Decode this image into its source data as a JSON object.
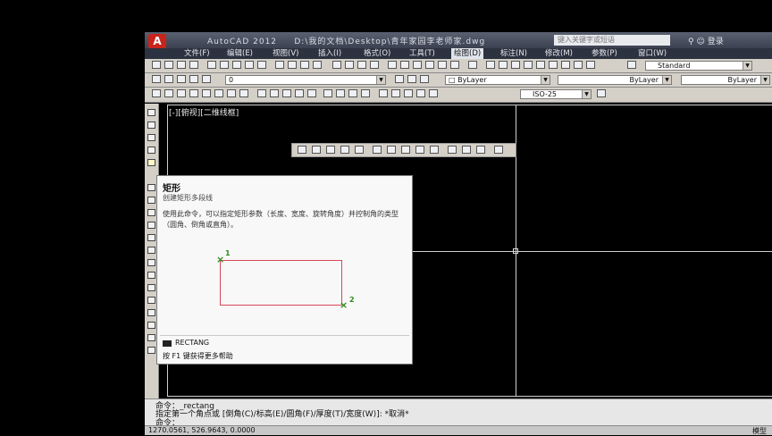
{
  "titlebar": {
    "app_name": "AutoCAD 2012",
    "file_path": "D:\\我的文档\\Desktop\\青年家园李老师家.dwg",
    "search_placeholder": "键入关键字或短语",
    "login": "登录"
  },
  "menu": {
    "items": [
      {
        "label": "文件(F)"
      },
      {
        "label": "编辑(E)"
      },
      {
        "label": "视图(V)"
      },
      {
        "label": "插入(I)"
      },
      {
        "label": "格式(O)"
      },
      {
        "label": "工具(T)"
      },
      {
        "label": "绘图(D)"
      },
      {
        "label": "标注(N)"
      },
      {
        "label": "修改(M)"
      },
      {
        "label": "参数(P)"
      },
      {
        "label": "窗口(W)"
      }
    ],
    "active_index": 6
  },
  "toolbar": {
    "text_style": "Standard",
    "layer": "0",
    "color": "ByLayer",
    "linetype": "ByLayer",
    "lineweight": "ByLayer",
    "dim_style": "ISO-25"
  },
  "canvas": {
    "viewport_label": "[-][俯视][二维线框]"
  },
  "tooltip": {
    "title": "矩形",
    "subtitle": "创建矩形多段线",
    "description": "使用此命令，可以指定矩形参数（长度、宽度、旋转角度）并控制角的类型（圆角、倒角或直角）。",
    "point1": "1",
    "point2": "2",
    "command": "RECTANG",
    "help": "按 F1 键获得更多帮助"
  },
  "command": {
    "line1": "命令：_rectang",
    "line2": "指定第一个角点或 [倒角(C)/标高(E)/圆角(F)/厚度(T)/宽度(W)]: *取消*",
    "line3": "命令："
  },
  "status": {
    "coords": "1270.0561, 526.9643, 0.0000",
    "model": "模型"
  }
}
